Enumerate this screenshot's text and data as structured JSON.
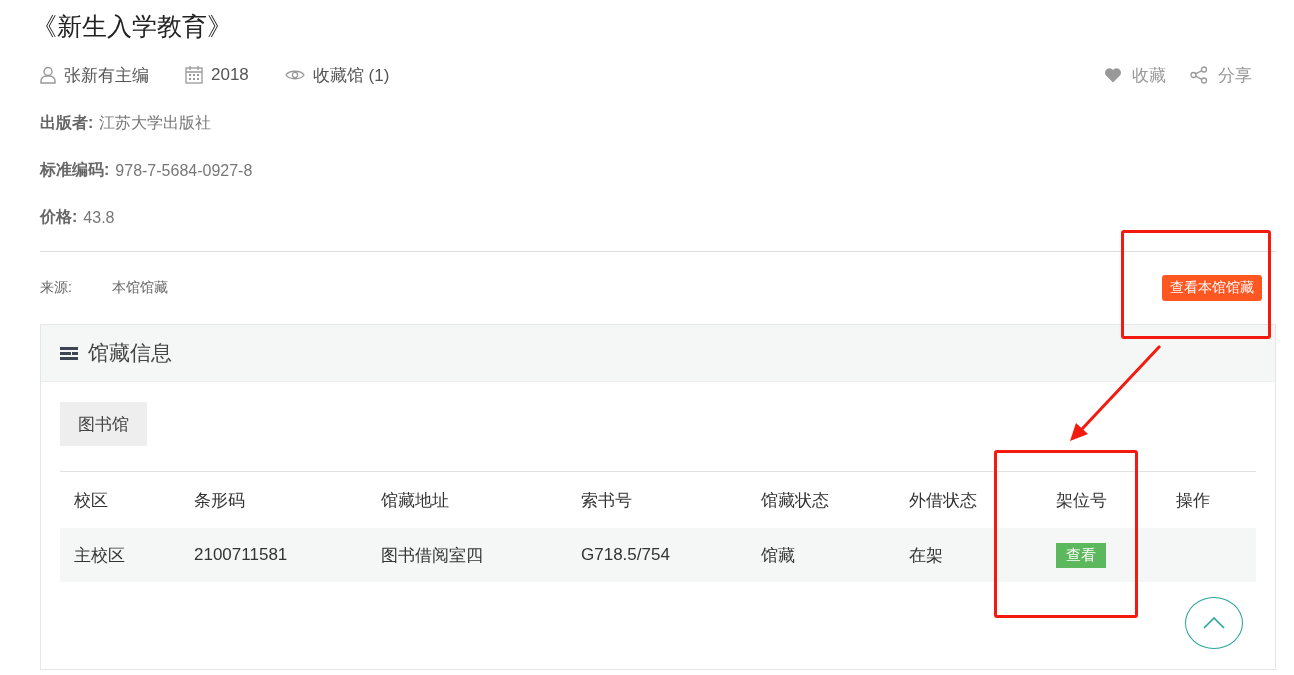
{
  "title": "《新生入学教育》",
  "meta": [
    {
      "kind": "author",
      "text": "张新有主编"
    },
    {
      "kind": "year",
      "text": "2018"
    },
    {
      "kind": "views",
      "text": "收藏馆 (1)"
    }
  ],
  "actions": [
    {
      "kind": "favorite",
      "text": "收藏"
    },
    {
      "kind": "share",
      "text": "分享"
    }
  ],
  "fields": [
    {
      "label": "出版者:",
      "value": "江苏大学出版社"
    },
    {
      "label": "标准编码:",
      "value": "978-7-5684-0927-8"
    },
    {
      "label": "价格:",
      "value": "43.8"
    }
  ],
  "source": {
    "label": "来源:",
    "value": "本馆馆藏",
    "button": "查看本馆馆藏"
  },
  "panel": {
    "title": "馆藏信息",
    "tabs": [
      {
        "label": "图书馆",
        "selected": true
      }
    ],
    "table": {
      "columns": [
        "校区",
        "条形码",
        "馆藏地址",
        "索书号",
        "馆藏状态",
        "外借状态",
        "架位号",
        "操作"
      ],
      "rows": [
        {
          "cells": [
            {
              "kind": "text",
              "text": "主校区"
            },
            {
              "kind": "text",
              "text": "2100711581"
            },
            {
              "kind": "text",
              "text": "图书借阅室四"
            },
            {
              "kind": "text",
              "text": "G718.5/754"
            },
            {
              "kind": "text",
              "text": "馆藏"
            },
            {
              "kind": "text",
              "text": "在架"
            },
            {
              "kind": "button",
              "text": "查看"
            }
          ]
        }
      ]
    }
  }
}
